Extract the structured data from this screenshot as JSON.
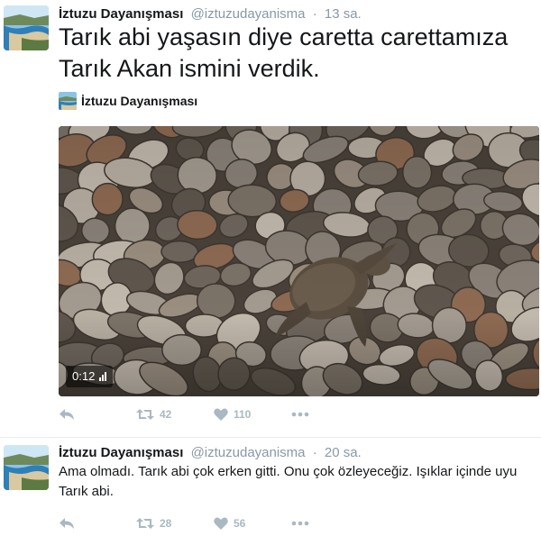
{
  "tweets": [
    {
      "author": "İztuzu Dayanışması",
      "handle": "@iztuzudayanisma",
      "separator": "·",
      "time": "13 sa.",
      "text": "Tarık abi yaşasın diye caretta carettamıza Tarık Akan ismini verdik.",
      "card": {
        "author": "İztuzu Dayanışması",
        "duration": "0:12"
      },
      "retweets": "42",
      "likes": "110"
    },
    {
      "author": "İztuzu Dayanışması",
      "handle": "@iztuzudayanisma",
      "separator": "·",
      "time": "20 sa.",
      "text": "Ama olmadı. Tarık abi çok erken gitti. Onu çok özleyeceğiz. Işıklar içinde uyu Tarık abi.",
      "retweets": "28",
      "likes": "56"
    }
  ],
  "icons": {
    "reply": "reply-icon",
    "retweet": "retweet-icon",
    "like": "heart-icon",
    "more": "more-icon"
  },
  "colors": {
    "text": "#14171a",
    "muted": "#8899a6",
    "action": "#aab8c2"
  }
}
